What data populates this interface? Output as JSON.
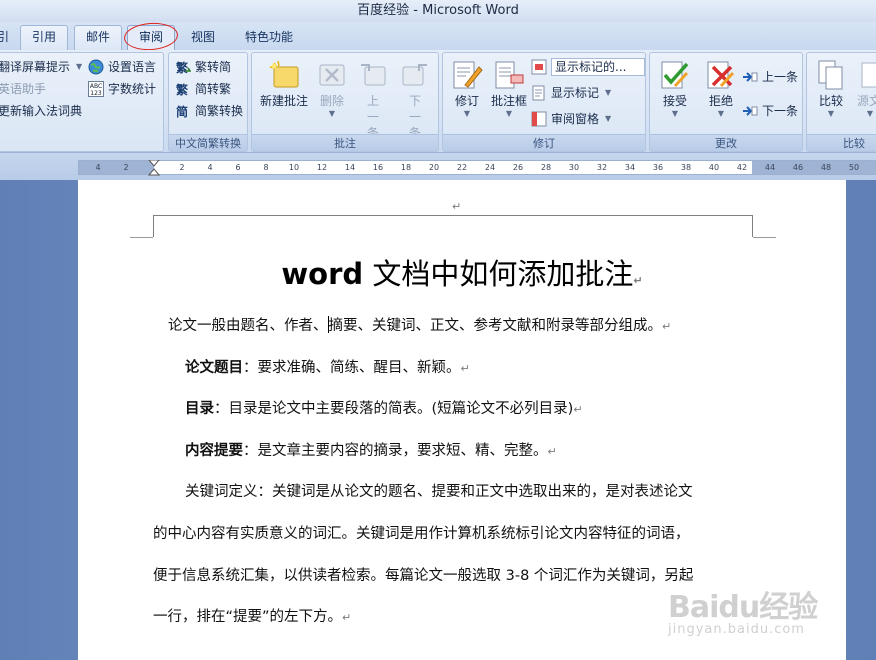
{
  "window": {
    "title": "百度经验 - Microsoft Word"
  },
  "tabs": [
    {
      "label": "引用"
    },
    {
      "label": "邮件"
    },
    {
      "label": "审阅"
    },
    {
      "label": "视图"
    },
    {
      "label": "特色功能"
    }
  ],
  "ribbon": {
    "chinese_tools": {
      "items": [
        "翻译屏幕提示",
        "英语助手",
        "更新输入法词典"
      ],
      "setlang": "设置语言",
      "wordcount": "字数统计"
    },
    "conversion": {
      "label": "中文简繁转换",
      "items": [
        "繁转简",
        "简转繁",
        "简繁转换"
      ]
    },
    "comments": {
      "label": "批注",
      "new": "新建批注",
      "delete": "删除",
      "prev": "上一条",
      "next": "下一条"
    },
    "tracking": {
      "label": "修订",
      "track": "修订",
      "balloons": "批注框",
      "show_markup_select": "显示标记的...",
      "show_markup": "显示标记",
      "reviewing_pane": "审阅窗格"
    },
    "changes": {
      "label": "更改",
      "accept": "接受",
      "reject": "拒绝",
      "prev": "上一条",
      "next": "下一条"
    },
    "compare": {
      "label": "比较",
      "compare": "比较",
      "source": "源文"
    }
  },
  "ruler": {
    "ticks": [
      "4",
      "2",
      "2",
      "4",
      "6",
      "8",
      "10",
      "12",
      "14",
      "16",
      "18",
      "20",
      "22",
      "24",
      "26",
      "28",
      "30",
      "32",
      "34",
      "36",
      "38",
      "40",
      "42",
      "44",
      "46",
      "48",
      "50"
    ]
  },
  "document": {
    "header_mark": "↵",
    "title_latin": "word",
    "title_zh": " 文档中如何添加批注",
    "para1_a": "论文一般由题名、作者、",
    "para1_b": "摘要、关键词、正文、参考文献和附录等部分组成。",
    "p2_bold": "论文题目",
    "p2_text": "：要求准确、简练、醒目、新颖。",
    "p3_bold": "目录",
    "p3_text": "：目录是论文中主要段落的简表。(短篇论文不必列目录)",
    "p4_bold": "内容提要",
    "p4_text": "：是文章主要内容的摘录，要求短、精、完整。",
    "p5_l1": "关键词定义：关键词是从论文的题名、提要和正文中选取出来的，是对表述论文",
    "p5_l2": "的中心内容有实质意义的词汇。关键词是用作计算机系统标引论文内容特征的词语，",
    "p5_l3": "便于信息系统汇集，以供读者检索。每篇论文一般选取 3-8 个词汇作为关键词，另起",
    "p5_l4": "一行，排在“提要”的左下方。",
    "pilcrow": "↵"
  },
  "watermark": {
    "logo": "Baidu经验",
    "url": "jingyan.baidu.com"
  }
}
